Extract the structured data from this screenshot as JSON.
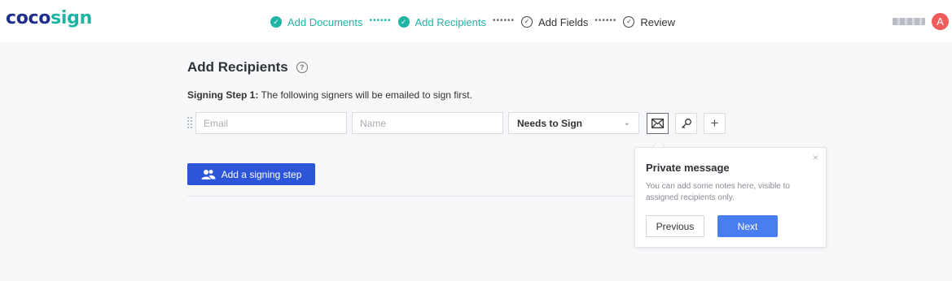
{
  "header": {
    "logo_main": "coco",
    "logo_accent": "sign",
    "steps": [
      {
        "label": "Add Documents",
        "state": "done",
        "icon": "check-circle-icon"
      },
      {
        "label": "Add Recipients",
        "state": "done",
        "icon": "check-circle-icon"
      },
      {
        "label": "Add Fields",
        "state": "todo",
        "icon": "check-outline-icon"
      },
      {
        "label": "Review",
        "state": "todo",
        "icon": "check-outline-icon"
      }
    ],
    "connector": "••••••",
    "user": {
      "avatar_letter": "A"
    }
  },
  "main": {
    "title": "Add Recipients",
    "help_glyph": "?",
    "signing_step_label": "Signing Step 1:",
    "signing_step_text": " The following signers will be emailed to sign first.",
    "recipient": {
      "email_placeholder": "Email",
      "name_placeholder": "Name",
      "role": "Needs to Sign",
      "chevron": "⌄"
    },
    "add_step_label": "Add a signing step"
  },
  "popover": {
    "title": "Private message",
    "body": "You can add some notes here, visible to assigned recipients only.",
    "previous": "Previous",
    "next": "Next",
    "close": "×"
  },
  "colors": {
    "brand_dark": "#1f2d8c",
    "accent": "#1db4a6",
    "primary_button": "#2d55d8",
    "next_button": "#4a7ef0",
    "avatar": "#ef5d5a"
  }
}
